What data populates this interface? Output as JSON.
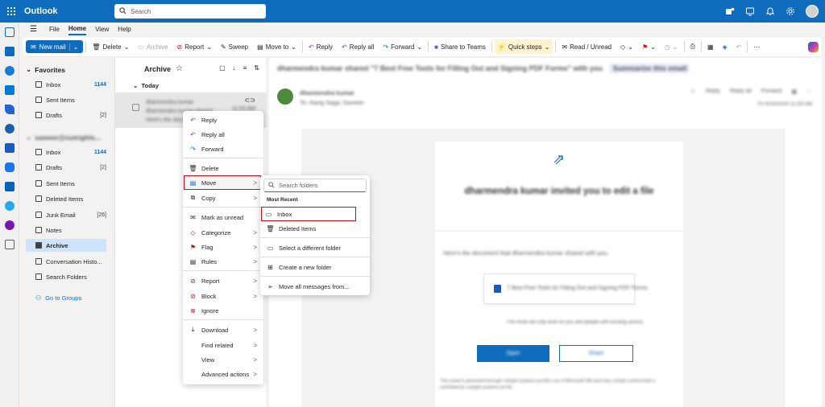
{
  "app": {
    "name": "Outlook"
  },
  "search": {
    "placeholder": "Search"
  },
  "menu_tabs": [
    "File",
    "Home",
    "View",
    "Help"
  ],
  "ribbon": {
    "new_mail": "New mail",
    "delete": "Delete",
    "archive": "Archive",
    "report": "Report",
    "sweep": "Sweep",
    "move_to": "Move to",
    "reply": "Reply",
    "reply_all": "Reply all",
    "forward": "Forward",
    "share_teams": "Share to Teams",
    "quick_steps": "Quick steps",
    "read_unread": "Read / Unread"
  },
  "folders": {
    "favorites_header": "Favorites",
    "favorites": [
      {
        "label": "Inbox",
        "count": "1144"
      },
      {
        "label": "Sent Items",
        "count": ""
      },
      {
        "label": "Drafts",
        "count": "[2]"
      }
    ],
    "account_header": "sameer@outrights...",
    "account": [
      {
        "label": "Inbox",
        "count": "1144"
      },
      {
        "label": "Drafts",
        "count": "[2]"
      },
      {
        "label": "Sent Items",
        "count": ""
      },
      {
        "label": "Deleted Items",
        "count": ""
      },
      {
        "label": "Junk Email",
        "count": "[26]"
      },
      {
        "label": "Notes",
        "count": ""
      },
      {
        "label": "Archive",
        "count": ""
      },
      {
        "label": "Conversation Histo...",
        "count": ""
      },
      {
        "label": "Search Folders",
        "count": ""
      }
    ],
    "go_to_groups": "Go to Groups"
  },
  "message_list": {
    "folder_title": "Archive",
    "group_label": "Today",
    "item": {
      "sender": "dharmendra kumar",
      "subject": "dharmendra kumar shared",
      "preview": "Here's the document that",
      "time": "11:53 AM"
    }
  },
  "reading_pane": {
    "subject": "dharmendra kumar shared \"7 Best Free Tools for Filling Out and Signing PDF Forms\" with you",
    "summarize": "Summarize this email",
    "from_name": "dharmendra kumar",
    "to_line": "To: Rang Saga; Sameer",
    "date": "Fri 6/14/2024 11:53 AM",
    "reply": "Reply",
    "reply_all": "Reply all",
    "forward": "Forward",
    "invite_title": "dharmendra kumar invited you to edit a file",
    "doc_intro": "Here's the document that dharmendra kumar shared with you.",
    "doc_name": "7 Best Free Tools for Filling Out and Signing PDF Forms",
    "link_note": "This invite will only work for you and people with existing access.",
    "open_btn": "Open",
    "share_btn": "Share",
    "footer": "This email is generated through outright systems pvt ltd's use of Microsoft 365 and may contain content that is controlled by outright systems pvt ltd."
  },
  "context_menu": {
    "items": [
      "Reply",
      "Reply all",
      "Forward",
      "Delete",
      "Move",
      "Copy",
      "Mark as unread",
      "Categorize",
      "Flag",
      "Rules",
      "Report",
      "Block",
      "Ignore",
      "Download",
      "Find related",
      "View",
      "Advanced actions"
    ]
  },
  "move_submenu": {
    "search_placeholder": "Search folders",
    "section": "Most Recent",
    "items": [
      "Inbox",
      "Deleted Items",
      "Select a different folder",
      "Create a new folder",
      "Move all messages from..."
    ]
  },
  "colors": {
    "brand": "#0f6cbd",
    "highlight": "#c50f1f",
    "selected": "#cfe4fa"
  }
}
